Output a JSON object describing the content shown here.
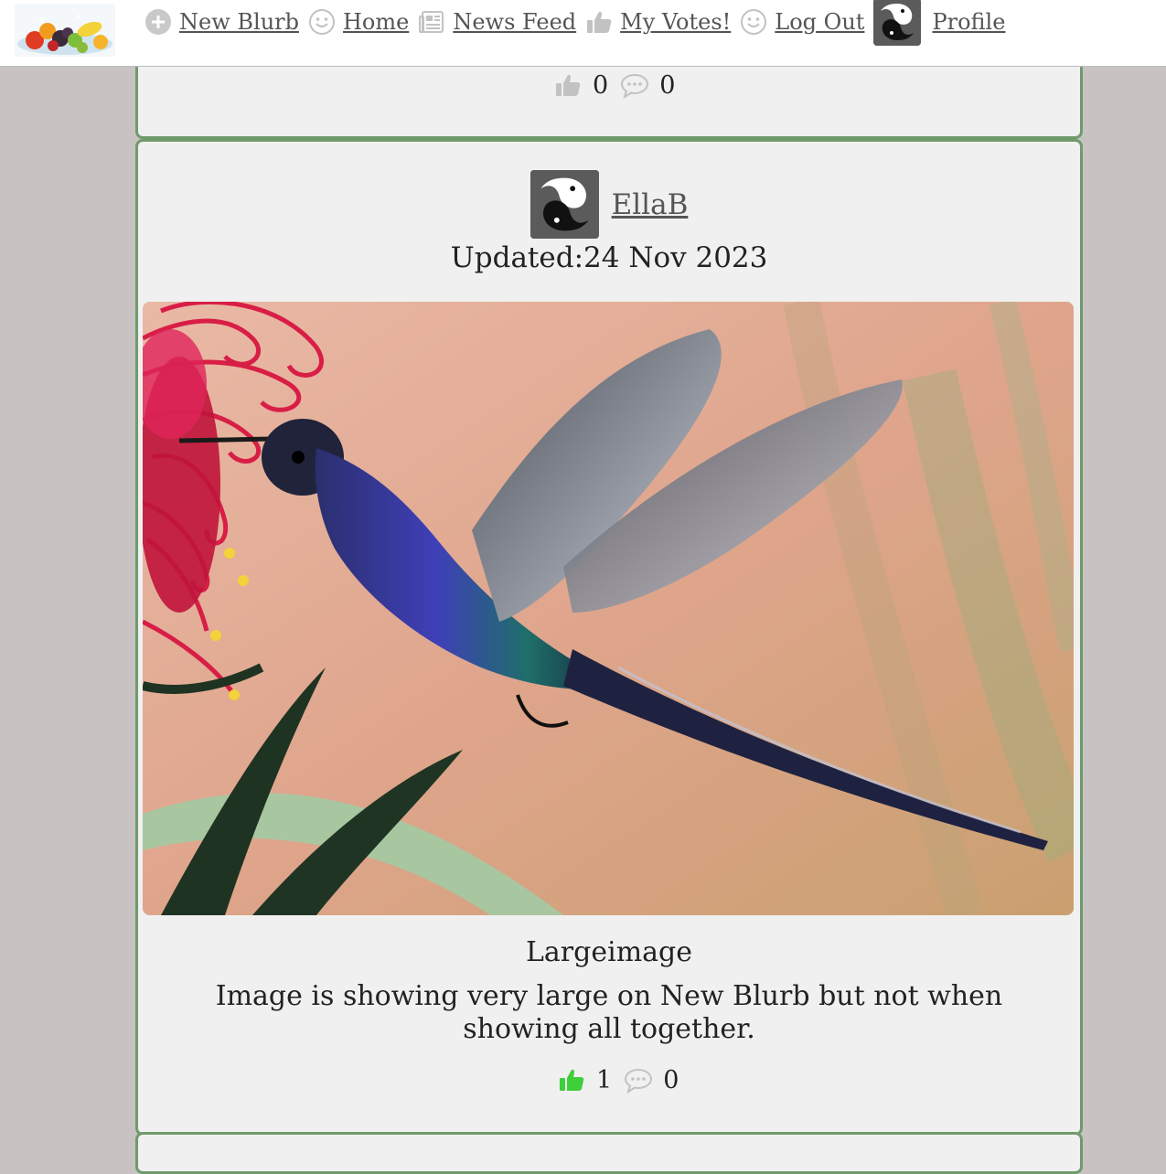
{
  "nav": {
    "logo_icon": "fruit-logo",
    "items": [
      {
        "label": "New Blurb",
        "icon": "plus-circle-icon"
      },
      {
        "label": "Home",
        "icon": "smiley-icon"
      },
      {
        "label": "News Feed",
        "icon": "newspaper-icon"
      },
      {
        "label": "My Votes!",
        "icon": "thumbs-up-icon"
      },
      {
        "label": "Log Out",
        "icon": "smiley-icon"
      },
      {
        "label": "Profile",
        "icon": "koi-avatar"
      }
    ]
  },
  "prev_post": {
    "likes": "0",
    "comments": "0"
  },
  "post": {
    "author": "EllaB",
    "updated": "Updated:24 Nov 2023",
    "image_subject": "hummingbird feeding on red flower",
    "title": "Largeimage",
    "body": "Image is showing very large on New Blurb but not when showing all together.",
    "likes": "1",
    "comments": "0",
    "liked_color": "#3ecf3a"
  },
  "colors": {
    "background": "#c8c3c2",
    "card": "#f0f0f0",
    "card_border": "#6f9b6c",
    "link": "#555555"
  }
}
